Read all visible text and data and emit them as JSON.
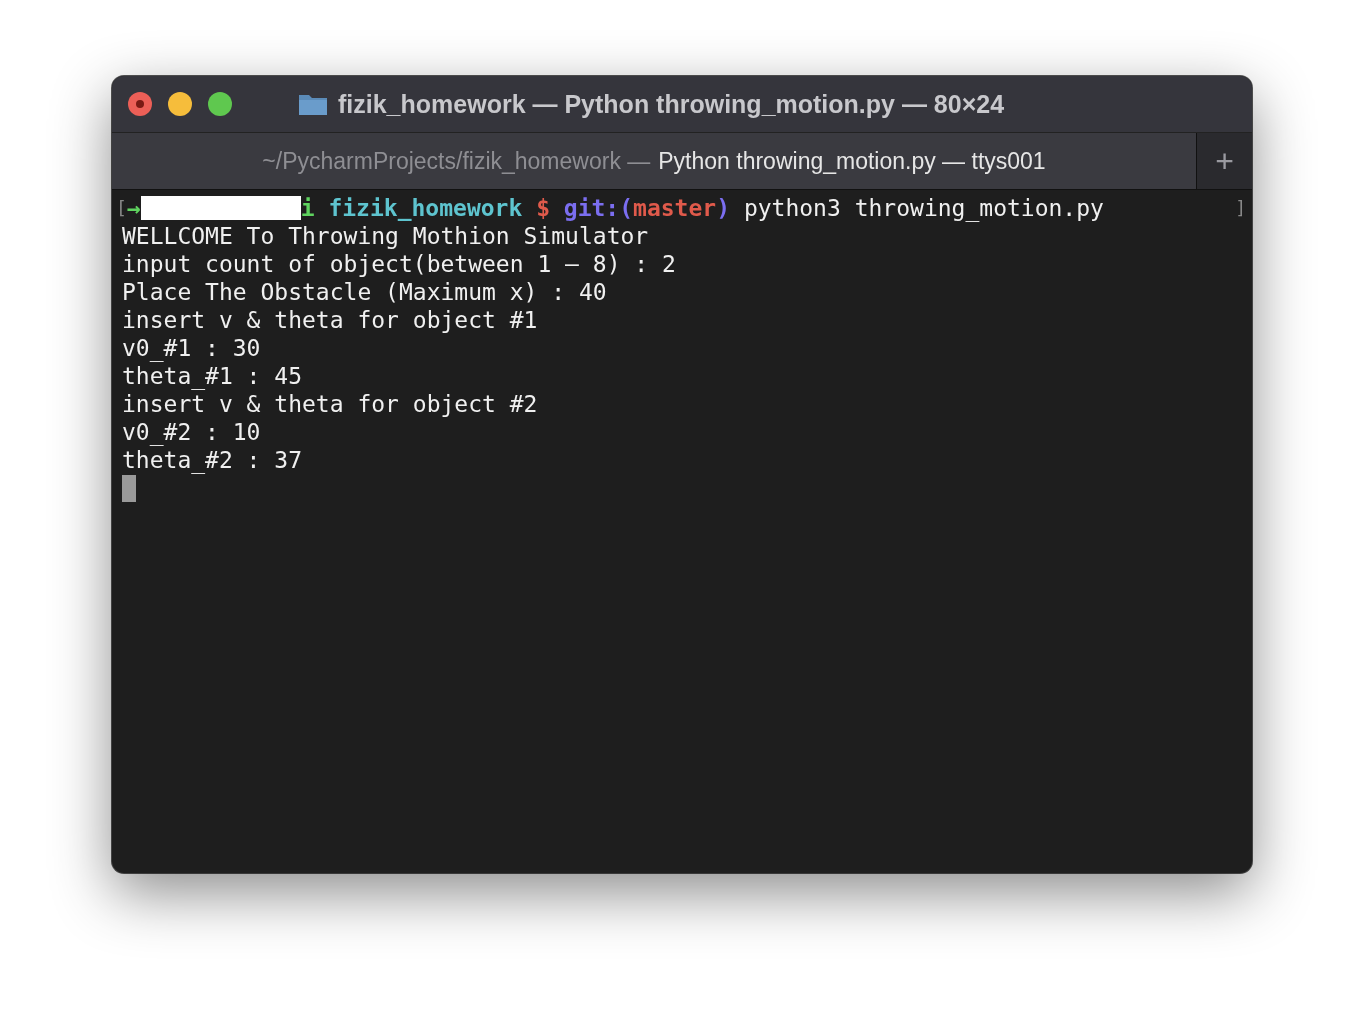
{
  "window": {
    "title": "fizik_homework — Python throwing_motion.py — 80×24",
    "controls": [
      {
        "kind": "close",
        "color": "#ec5f57"
      },
      {
        "kind": "minimize",
        "color": "#f6bd3b"
      },
      {
        "kind": "zoom",
        "color": "#5fc84f"
      }
    ]
  },
  "tab": {
    "path": "~/PycharmProjects/fizik_homework —",
    "process": "Python throwing_motion.py — ttys001",
    "selected": true,
    "new_tab": "+"
  },
  "prompt": {
    "open": "[",
    "close": "]",
    "segments": [
      {
        "kind": "arrow",
        "text": "→"
      },
      {
        "kind": "redacted"
      },
      {
        "kind": "user",
        "text": "i"
      },
      {
        "kind": "dir",
        "text": " fizik_homework"
      },
      {
        "kind": "dollar",
        "text": " $"
      },
      {
        "kind": "git",
        "text": " git:("
      },
      {
        "kind": "branch",
        "text": "master"
      },
      {
        "kind": "git",
        "text": ")"
      },
      {
        "kind": "command",
        "text": " python3 throwing_motion.py"
      }
    ]
  },
  "output": [
    "WELLCOME To Throwing Mothion Simulator",
    "input count of object(between 1 – 8) : 2",
    "Place The Obstacle (Maximum x) : 40",
    "insert v & theta for object #1",
    "v0_#1 : 30",
    "theta_#1 : 45",
    "insert v & theta for object #2",
    "v0_#2 : 10",
    "theta_#2 : 37"
  ],
  "cursor": {
    "visible": true
  }
}
